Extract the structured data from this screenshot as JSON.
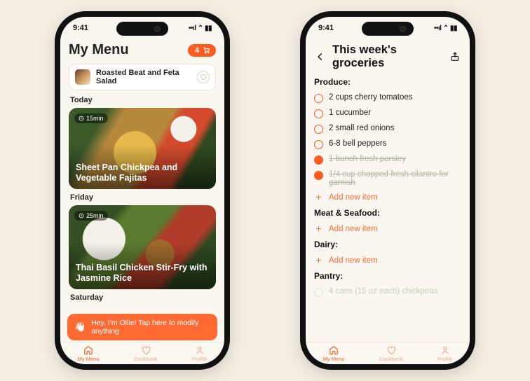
{
  "status": {
    "time": "9:41",
    "indicators": "••ıl ⌃ ▮▮"
  },
  "left": {
    "title": "My Menu",
    "cart_count": "4",
    "banner": {
      "title": "Roasted Beat and Feta Salad"
    },
    "days": [
      {
        "label": "Today",
        "card": {
          "time": "15min",
          "title": "Sheet Pan Chickpea and Vegetable Fajitas"
        }
      },
      {
        "label": "Friday",
        "card": {
          "time": "25min",
          "title": "Thai Basil Chicken Stir-Fry with Jasmine Rice"
        }
      },
      {
        "label": "Saturday"
      }
    ],
    "mod_bar": "Hey, I'm Ollie! Tap here to modify anything"
  },
  "right": {
    "title": "This week's groceries",
    "sections": [
      {
        "head": "Produce:",
        "items": [
          {
            "text": "2 cups cherry tomatoes",
            "done": false
          },
          {
            "text": "1 cucumber",
            "done": false
          },
          {
            "text": "2 small red onions",
            "done": false
          },
          {
            "text": "6-8 bell peppers",
            "done": false
          },
          {
            "text": "1 bunch fresh parsley",
            "done": true
          },
          {
            "text": "1/4 cup chopped fresh cilantro for garnish",
            "done": true
          }
        ],
        "add": "Add new item"
      },
      {
        "head": "Meat & Seafood:",
        "items": [],
        "add": "Add new item"
      },
      {
        "head": "Dairy:",
        "items": [],
        "add": "Add new item"
      },
      {
        "head": "Pantry:",
        "items": [
          {
            "text": "4 cans (15 oz each) chickpeas",
            "done": false,
            "faded": true
          }
        ]
      }
    ]
  },
  "tabs": [
    {
      "label": "My Menu"
    },
    {
      "label": "Cookbook"
    },
    {
      "label": "Profile"
    }
  ]
}
